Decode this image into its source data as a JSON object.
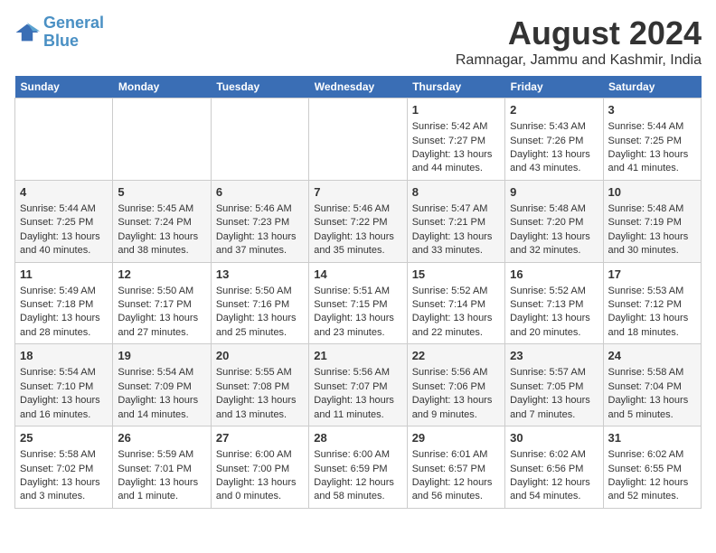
{
  "logo": {
    "line1": "General",
    "line2": "Blue"
  },
  "title": "August 2024",
  "subtitle": "Ramnagar, Jammu and Kashmir, India",
  "days_of_week": [
    "Sunday",
    "Monday",
    "Tuesday",
    "Wednesday",
    "Thursday",
    "Friday",
    "Saturday"
  ],
  "weeks": [
    [
      {
        "day": "",
        "content": ""
      },
      {
        "day": "",
        "content": ""
      },
      {
        "day": "",
        "content": ""
      },
      {
        "day": "",
        "content": ""
      },
      {
        "day": "1",
        "content": "Sunrise: 5:42 AM\nSunset: 7:27 PM\nDaylight: 13 hours\nand 44 minutes."
      },
      {
        "day": "2",
        "content": "Sunrise: 5:43 AM\nSunset: 7:26 PM\nDaylight: 13 hours\nand 43 minutes."
      },
      {
        "day": "3",
        "content": "Sunrise: 5:44 AM\nSunset: 7:25 PM\nDaylight: 13 hours\nand 41 minutes."
      }
    ],
    [
      {
        "day": "4",
        "content": "Sunrise: 5:44 AM\nSunset: 7:25 PM\nDaylight: 13 hours\nand 40 minutes."
      },
      {
        "day": "5",
        "content": "Sunrise: 5:45 AM\nSunset: 7:24 PM\nDaylight: 13 hours\nand 38 minutes."
      },
      {
        "day": "6",
        "content": "Sunrise: 5:46 AM\nSunset: 7:23 PM\nDaylight: 13 hours\nand 37 minutes."
      },
      {
        "day": "7",
        "content": "Sunrise: 5:46 AM\nSunset: 7:22 PM\nDaylight: 13 hours\nand 35 minutes."
      },
      {
        "day": "8",
        "content": "Sunrise: 5:47 AM\nSunset: 7:21 PM\nDaylight: 13 hours\nand 33 minutes."
      },
      {
        "day": "9",
        "content": "Sunrise: 5:48 AM\nSunset: 7:20 PM\nDaylight: 13 hours\nand 32 minutes."
      },
      {
        "day": "10",
        "content": "Sunrise: 5:48 AM\nSunset: 7:19 PM\nDaylight: 13 hours\nand 30 minutes."
      }
    ],
    [
      {
        "day": "11",
        "content": "Sunrise: 5:49 AM\nSunset: 7:18 PM\nDaylight: 13 hours\nand 28 minutes."
      },
      {
        "day": "12",
        "content": "Sunrise: 5:50 AM\nSunset: 7:17 PM\nDaylight: 13 hours\nand 27 minutes."
      },
      {
        "day": "13",
        "content": "Sunrise: 5:50 AM\nSunset: 7:16 PM\nDaylight: 13 hours\nand 25 minutes."
      },
      {
        "day": "14",
        "content": "Sunrise: 5:51 AM\nSunset: 7:15 PM\nDaylight: 13 hours\nand 23 minutes."
      },
      {
        "day": "15",
        "content": "Sunrise: 5:52 AM\nSunset: 7:14 PM\nDaylight: 13 hours\nand 22 minutes."
      },
      {
        "day": "16",
        "content": "Sunrise: 5:52 AM\nSunset: 7:13 PM\nDaylight: 13 hours\nand 20 minutes."
      },
      {
        "day": "17",
        "content": "Sunrise: 5:53 AM\nSunset: 7:12 PM\nDaylight: 13 hours\nand 18 minutes."
      }
    ],
    [
      {
        "day": "18",
        "content": "Sunrise: 5:54 AM\nSunset: 7:10 PM\nDaylight: 13 hours\nand 16 minutes."
      },
      {
        "day": "19",
        "content": "Sunrise: 5:54 AM\nSunset: 7:09 PM\nDaylight: 13 hours\nand 14 minutes."
      },
      {
        "day": "20",
        "content": "Sunrise: 5:55 AM\nSunset: 7:08 PM\nDaylight: 13 hours\nand 13 minutes."
      },
      {
        "day": "21",
        "content": "Sunrise: 5:56 AM\nSunset: 7:07 PM\nDaylight: 13 hours\nand 11 minutes."
      },
      {
        "day": "22",
        "content": "Sunrise: 5:56 AM\nSunset: 7:06 PM\nDaylight: 13 hours\nand 9 minutes."
      },
      {
        "day": "23",
        "content": "Sunrise: 5:57 AM\nSunset: 7:05 PM\nDaylight: 13 hours\nand 7 minutes."
      },
      {
        "day": "24",
        "content": "Sunrise: 5:58 AM\nSunset: 7:04 PM\nDaylight: 13 hours\nand 5 minutes."
      }
    ],
    [
      {
        "day": "25",
        "content": "Sunrise: 5:58 AM\nSunset: 7:02 PM\nDaylight: 13 hours\nand 3 minutes."
      },
      {
        "day": "26",
        "content": "Sunrise: 5:59 AM\nSunset: 7:01 PM\nDaylight: 13 hours\nand 1 minute."
      },
      {
        "day": "27",
        "content": "Sunrise: 6:00 AM\nSunset: 7:00 PM\nDaylight: 13 hours\nand 0 minutes."
      },
      {
        "day": "28",
        "content": "Sunrise: 6:00 AM\nSunset: 6:59 PM\nDaylight: 12 hours\nand 58 minutes."
      },
      {
        "day": "29",
        "content": "Sunrise: 6:01 AM\nSunset: 6:57 PM\nDaylight: 12 hours\nand 56 minutes."
      },
      {
        "day": "30",
        "content": "Sunrise: 6:02 AM\nSunset: 6:56 PM\nDaylight: 12 hours\nand 54 minutes."
      },
      {
        "day": "31",
        "content": "Sunrise: 6:02 AM\nSunset: 6:55 PM\nDaylight: 12 hours\nand 52 minutes."
      }
    ]
  ]
}
